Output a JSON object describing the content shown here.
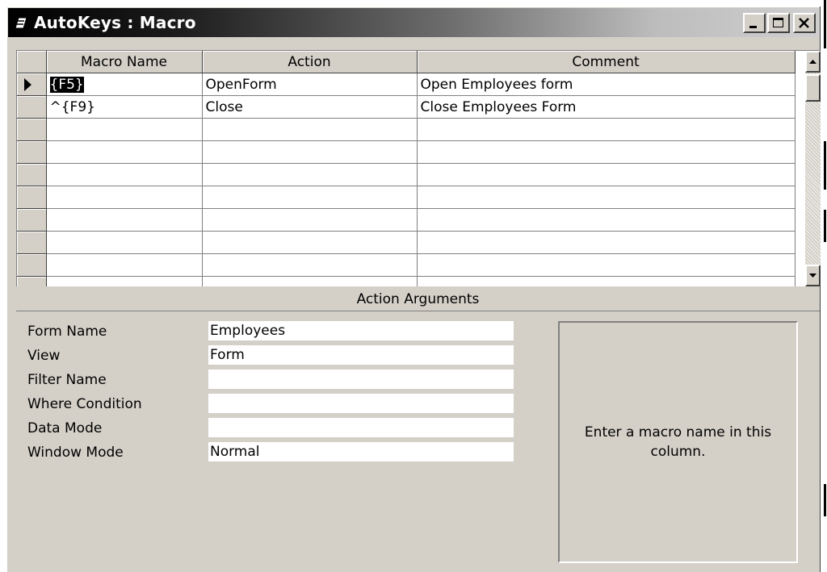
{
  "window": {
    "title": "AutoKeys : Macro"
  },
  "grid": {
    "headers": [
      "Macro Name",
      "Action",
      "Comment"
    ],
    "rows": [
      {
        "macro_prefix": "",
        "macro_selected": "{F5}",
        "action": "OpenForm",
        "comment": "Open Employees form"
      },
      {
        "macro_prefix": "^{F9}",
        "macro_selected": "",
        "action": "Close",
        "comment": "Close Employees Form"
      },
      {
        "macro_prefix": "",
        "macro_selected": "",
        "action": "",
        "comment": ""
      },
      {
        "macro_prefix": "",
        "macro_selected": "",
        "action": "",
        "comment": ""
      },
      {
        "macro_prefix": "",
        "macro_selected": "",
        "action": "",
        "comment": ""
      },
      {
        "macro_prefix": "",
        "macro_selected": "",
        "action": "",
        "comment": ""
      },
      {
        "macro_prefix": "",
        "macro_selected": "",
        "action": "",
        "comment": ""
      },
      {
        "macro_prefix": "",
        "macro_selected": "",
        "action": "",
        "comment": ""
      },
      {
        "macro_prefix": "",
        "macro_selected": "",
        "action": "",
        "comment": ""
      },
      {
        "macro_prefix": "",
        "macro_selected": "",
        "action": "",
        "comment": ""
      }
    ]
  },
  "arguments": {
    "header": "Action Arguments",
    "fields": [
      {
        "label": "Form Name",
        "value": "Employees"
      },
      {
        "label": "View",
        "value": "Form"
      },
      {
        "label": "Filter Name",
        "value": ""
      },
      {
        "label": "Where Condition",
        "value": ""
      },
      {
        "label": "Data Mode",
        "value": ""
      },
      {
        "label": "Window Mode",
        "value": "Normal"
      }
    ],
    "help_text": "Enter a macro name in this column."
  },
  "icons": {
    "title": "macro-icon",
    "minimize": "minimize-icon",
    "maximize": "maximize-icon",
    "close": "close-icon",
    "row_selector": "current-record-pointer-icon"
  }
}
